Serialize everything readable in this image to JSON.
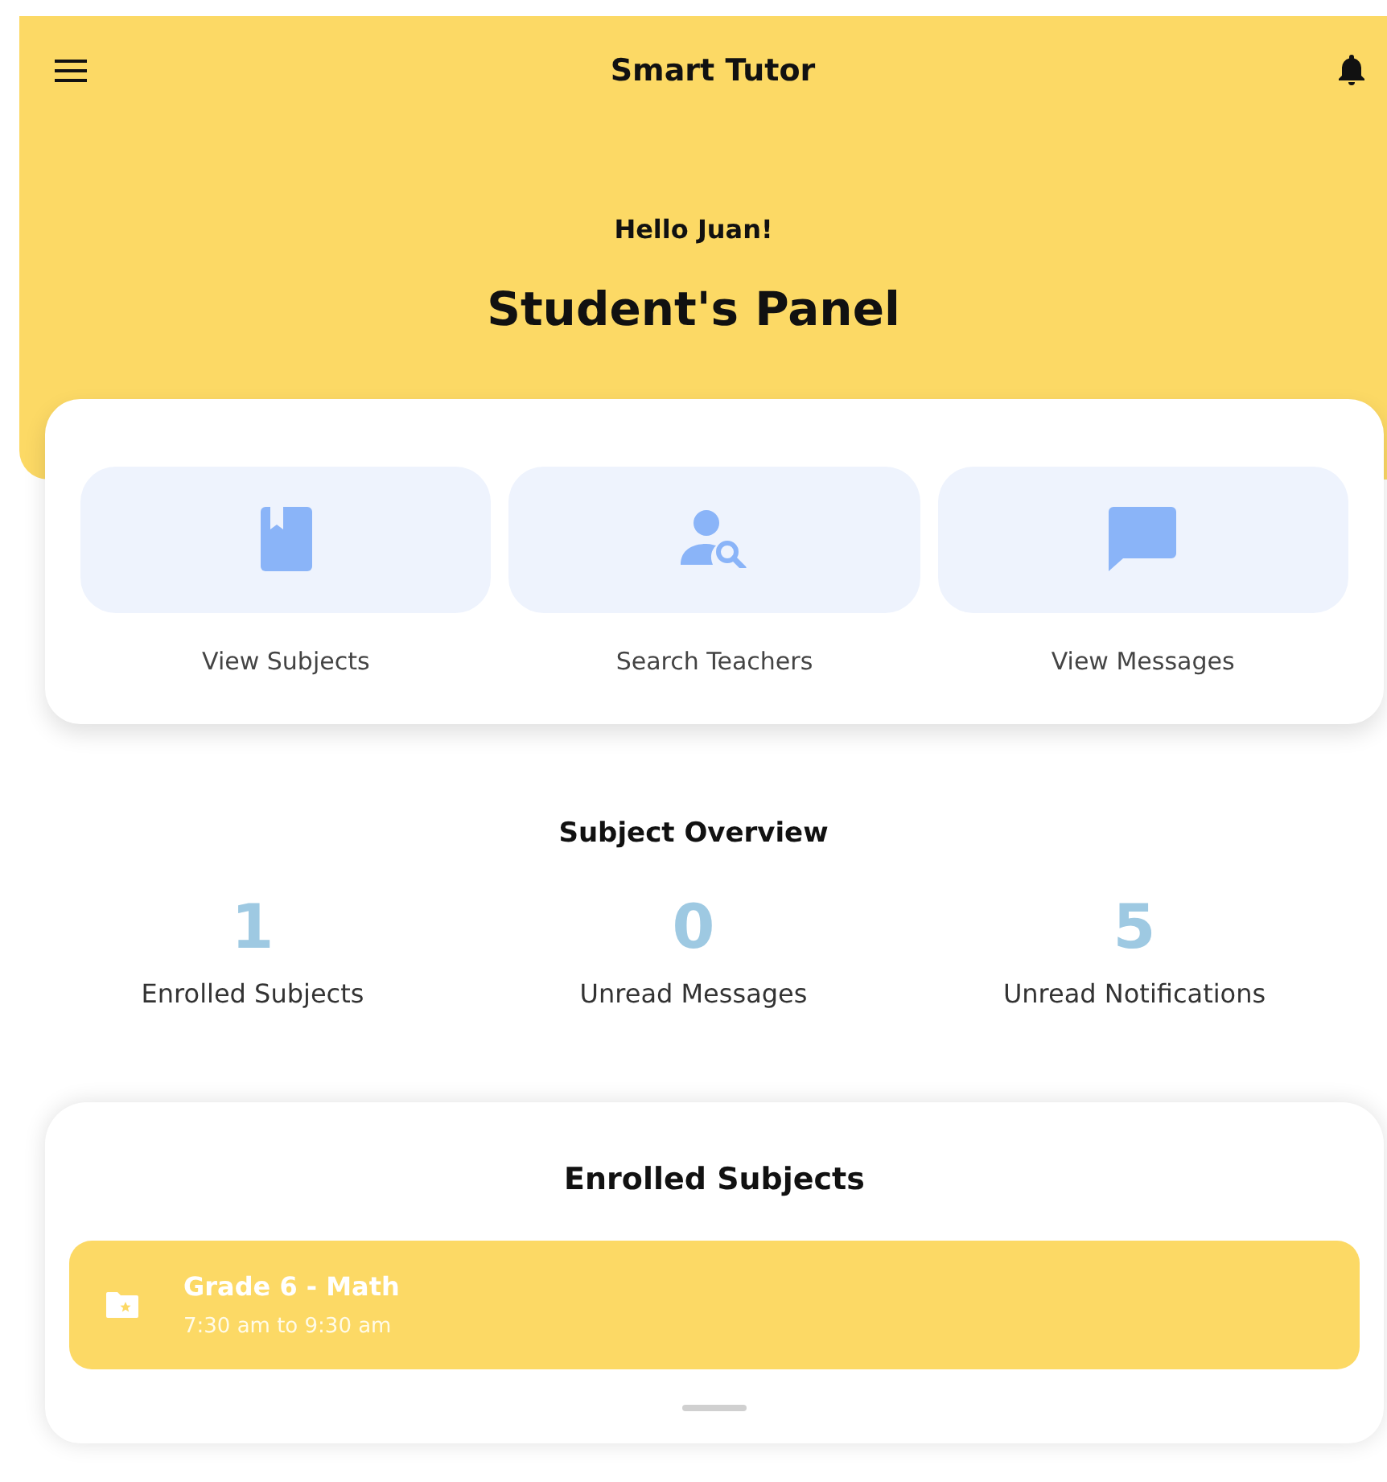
{
  "app_bar": {
    "title": "Smart Tutor"
  },
  "greeting": "Hello Juan!",
  "panel_title": "Student's Panel",
  "actions": [
    {
      "kind": "book",
      "label": "View Subjects"
    },
    {
      "kind": "person-search",
      "label": "Search Teachers"
    },
    {
      "kind": "chat",
      "label": "View Messages"
    }
  ],
  "overview": {
    "title": "Subject Overview",
    "stats": [
      {
        "value": "1",
        "label": "Enrolled Subjects"
      },
      {
        "value": "0",
        "label": "Unread Messages"
      },
      {
        "value": "5",
        "label": "Unread Notifications"
      }
    ]
  },
  "enrolled": {
    "title": "Enrolled Subjects",
    "items": [
      {
        "name": "Grade 6 - Math",
        "time": "7:30 am to 9:30 am"
      }
    ]
  }
}
